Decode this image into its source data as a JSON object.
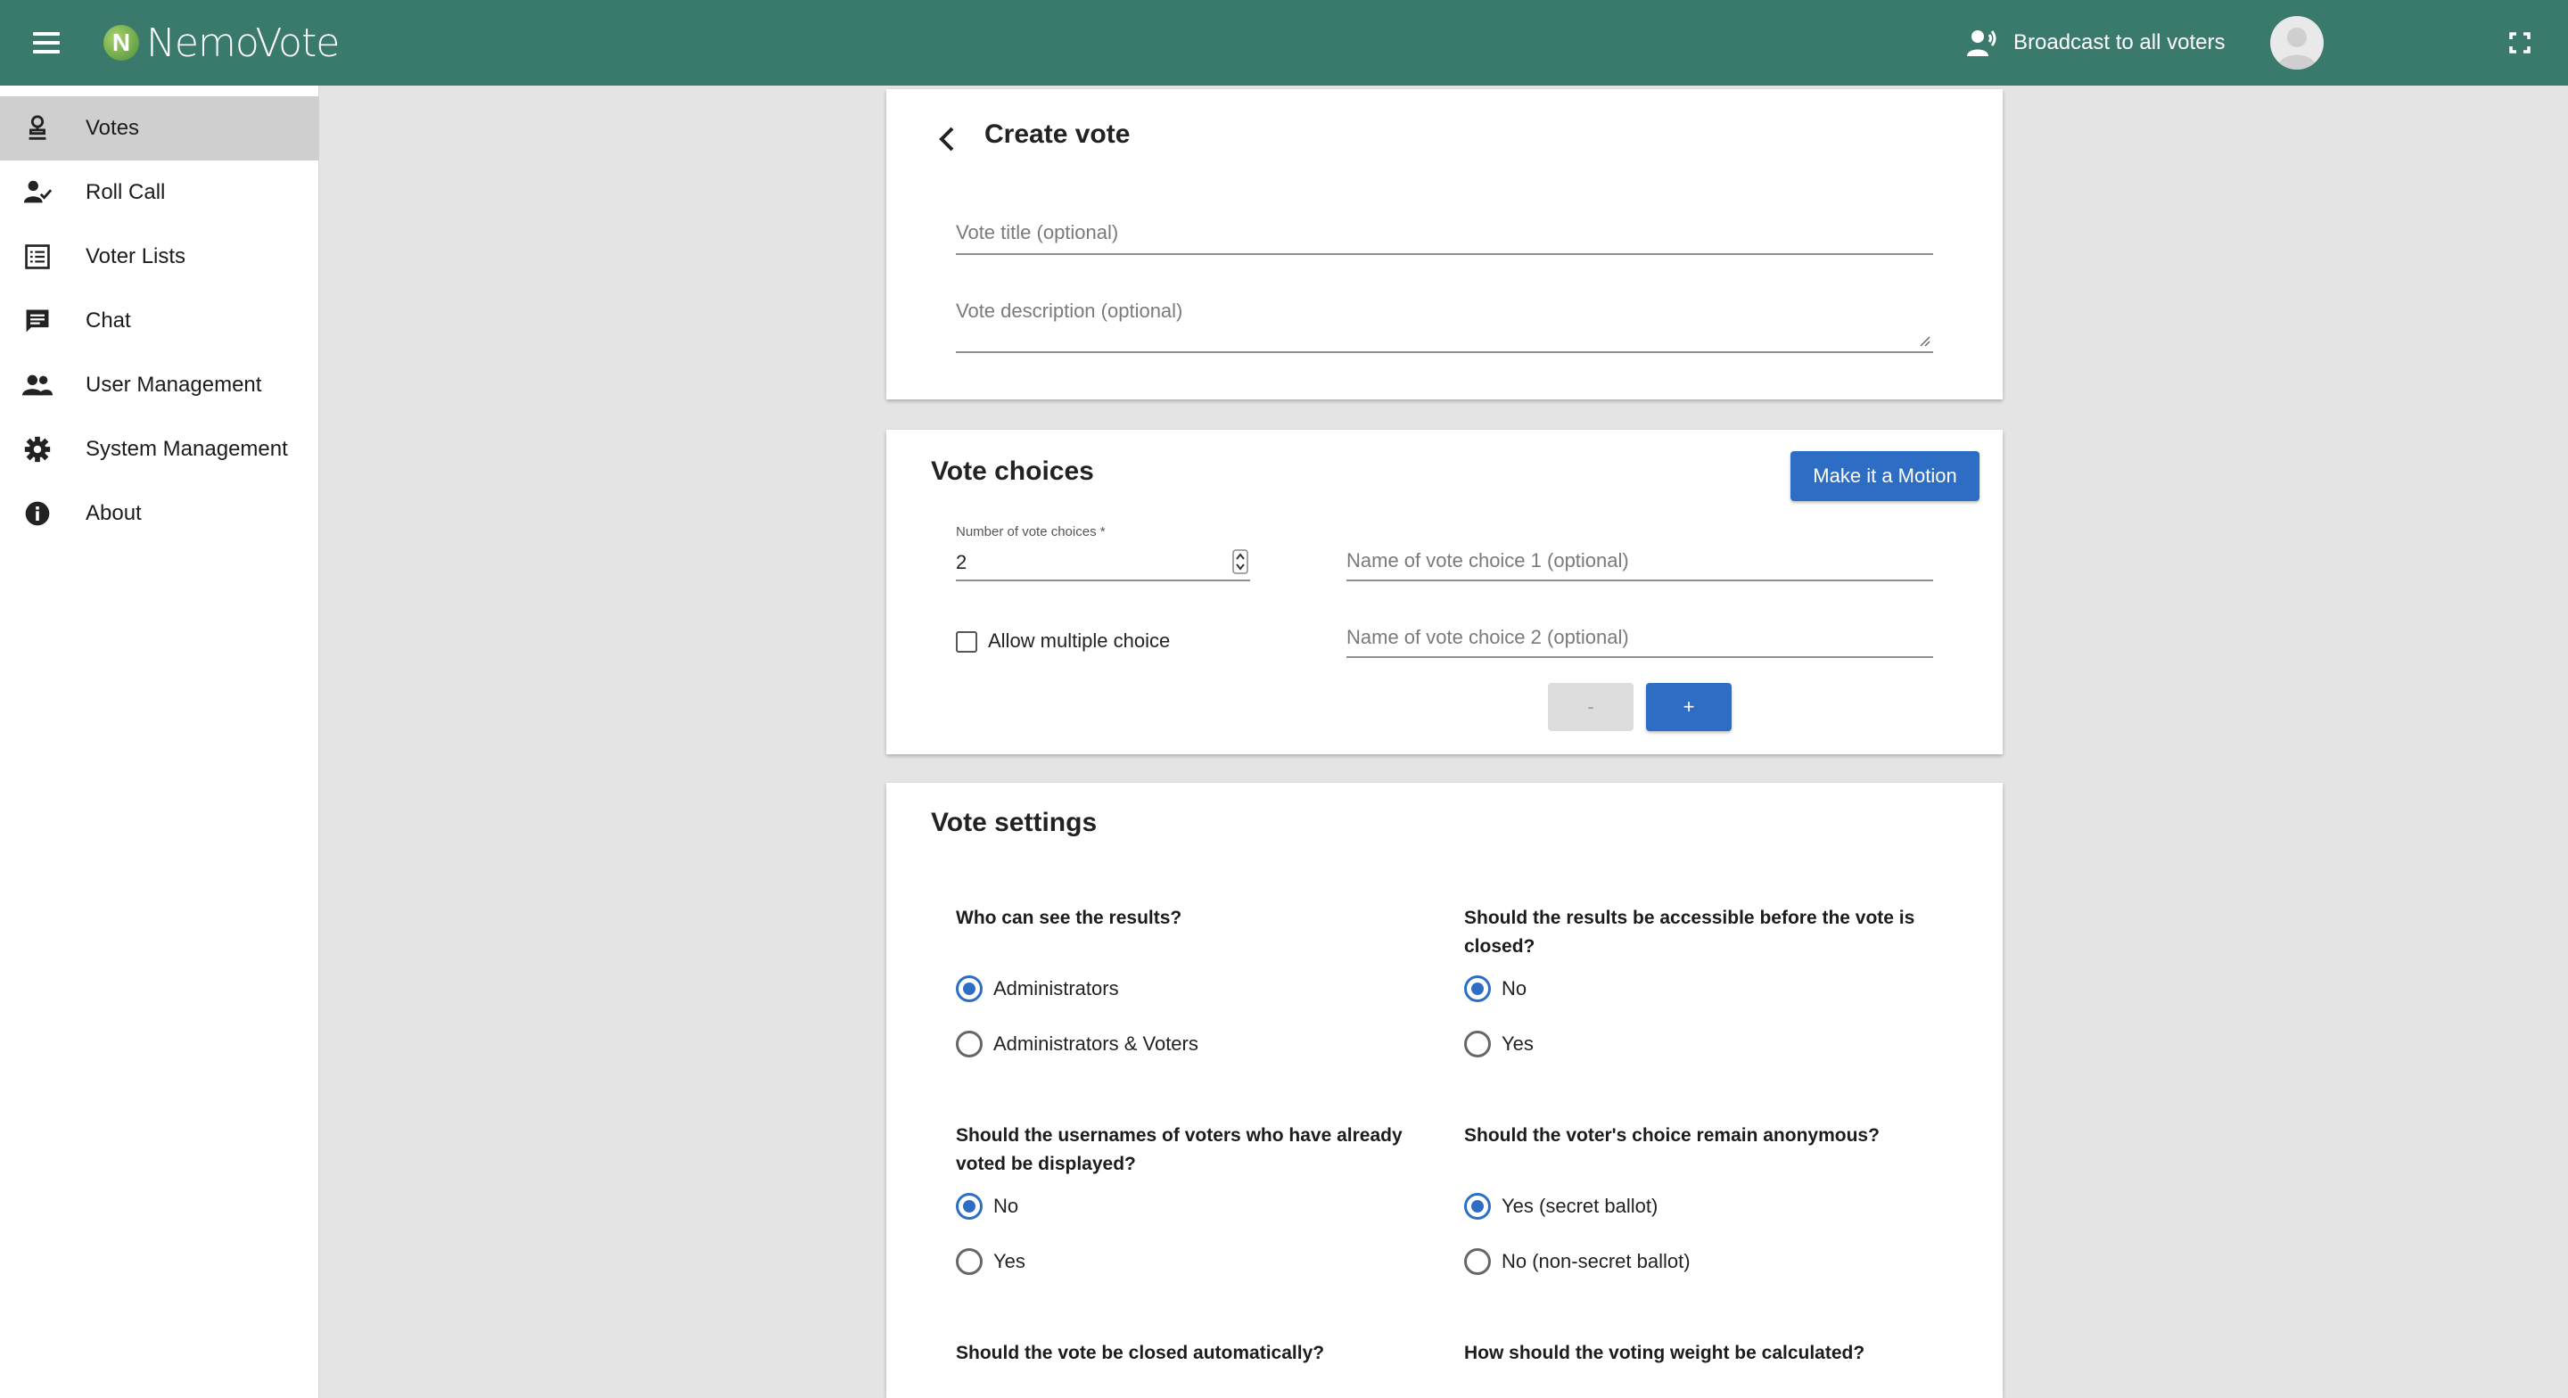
{
  "header": {
    "logo_letter": "N",
    "logo_text": "NemoVote",
    "broadcast_label": "Broadcast to all voters"
  },
  "sidebar": {
    "items": [
      {
        "label": "Votes",
        "icon": "ballot-stamp-icon",
        "active": true
      },
      {
        "label": "Roll Call",
        "icon": "person-check-icon"
      },
      {
        "label": "Voter Lists",
        "icon": "list-icon"
      },
      {
        "label": "Chat",
        "icon": "chat-icon"
      },
      {
        "label": "User Management",
        "icon": "people-icon"
      },
      {
        "label": "System Management",
        "icon": "gear-icon"
      },
      {
        "label": "About",
        "icon": "info-icon"
      }
    ]
  },
  "create_vote": {
    "title": "Create vote",
    "title_placeholder": "Vote title (optional)",
    "description_placeholder": "Vote description (optional)"
  },
  "vote_choices": {
    "title": "Vote choices",
    "motion_button": "Make it a Motion",
    "number_label": "Number of vote choices *",
    "number_value": "2",
    "allow_multiple_label": "Allow multiple choice",
    "allow_multiple_checked": false,
    "choices": [
      {
        "placeholder": "Name of vote choice 1 (optional)"
      },
      {
        "placeholder": "Name of vote choice 2 (optional)"
      }
    ],
    "minus_label": "-",
    "plus_label": "+"
  },
  "vote_settings": {
    "title": "Vote settings",
    "questions": [
      {
        "text": "Who can see the results?",
        "options": [
          "Administrators",
          "Administrators & Voters"
        ],
        "selected": 0
      },
      {
        "text": "Should the results be accessible before the vote is closed?",
        "options": [
          "No",
          "Yes"
        ],
        "selected": 0
      },
      {
        "text": "Should the usernames of voters who have already voted be displayed?",
        "options": [
          "No",
          "Yes"
        ],
        "selected": 0
      },
      {
        "text": "Should the voter's choice remain anonymous?",
        "options": [
          "Yes (secret ballot)",
          "No (non-secret ballot)"
        ],
        "selected": 0
      },
      {
        "text": "Should the vote be closed automatically?"
      },
      {
        "text": "How should the voting weight be calculated?"
      }
    ]
  },
  "colors": {
    "header_bg": "#3a7a6c",
    "primary": "#2d6ec4",
    "active_nav": "#cfcfcf",
    "page_bg": "#e4e4e4"
  }
}
